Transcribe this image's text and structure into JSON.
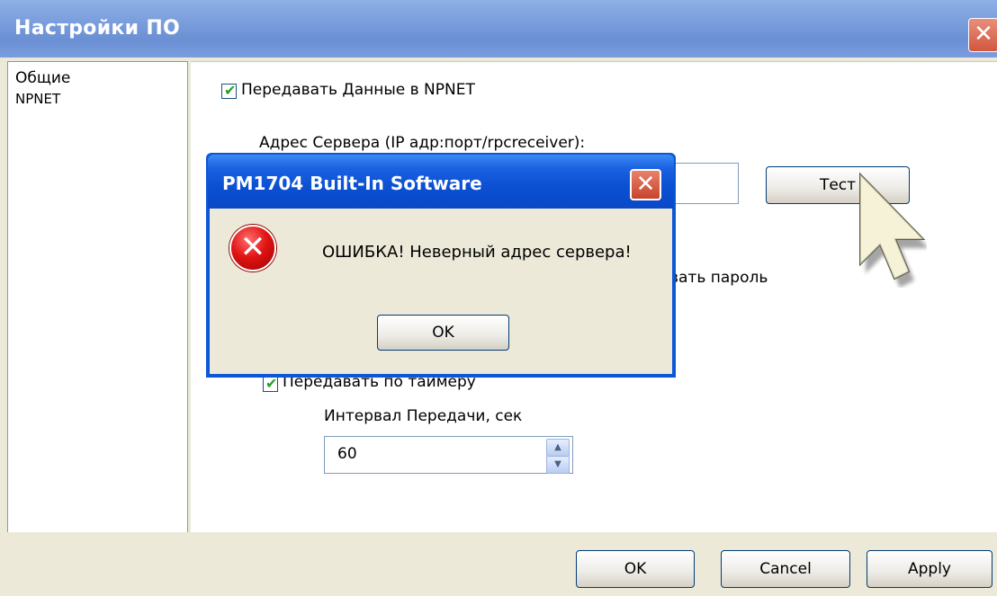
{
  "window": {
    "title": "Настройки ПО",
    "close_glyph": "✕"
  },
  "nav": {
    "items": [
      {
        "label": "Общие"
      },
      {
        "label": "NPNET"
      }
    ]
  },
  "content": {
    "transmit_checkbox_label": "Передавать Данные в NPNET",
    "transmit_checked": true,
    "server_address_label": "Адрес Сервера (IP адр:порт/rpcreceiver):",
    "server_address_value": "",
    "test_button": "Тест",
    "password_fragment": "вать пароль",
    "timer_checkbox_label": "Передавать по таймеру",
    "timer_checked": true,
    "interval_label": "Интервал Передачи, сек",
    "interval_value": "60"
  },
  "buttons": {
    "ok": "OK",
    "cancel": "Cancel",
    "apply": "Apply"
  },
  "dialog": {
    "title": "PM1704 Built-In Software",
    "message": "ОШИБКА! Неверный адрес сервера!",
    "ok": "OK",
    "close_glyph": "✕",
    "icon": "error-icon"
  }
}
